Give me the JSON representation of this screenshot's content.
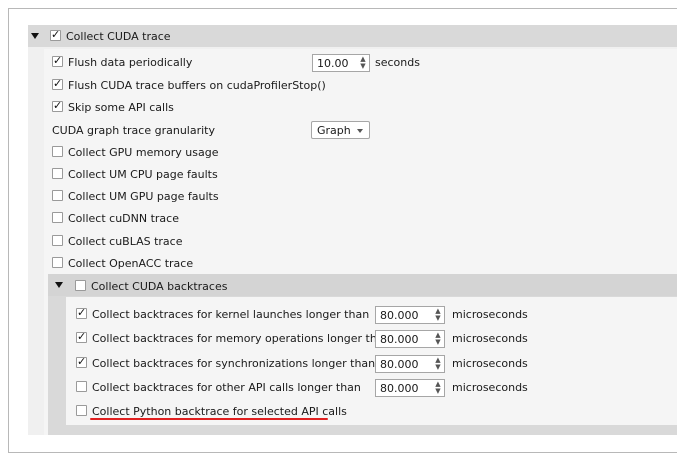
{
  "cuda_trace": {
    "label": "Collect CUDA trace",
    "checked": true,
    "flush_periodically": {
      "label": "Flush data periodically",
      "checked": true,
      "value": "10.00",
      "unit": "seconds"
    },
    "flush_on_stop": {
      "label": "Flush CUDA trace buffers on cudaProfilerStop()",
      "checked": true
    },
    "skip_api": {
      "label": "Skip some API calls",
      "checked": true
    },
    "graph_granularity": {
      "label": "CUDA graph trace granularity",
      "value": "Graph"
    },
    "options": [
      {
        "label": "Collect GPU memory usage",
        "checked": false
      },
      {
        "label": "Collect UM CPU page faults",
        "checked": false
      },
      {
        "label": "Collect UM GPU page faults",
        "checked": false
      },
      {
        "label": "Collect cuDNN trace",
        "checked": false
      },
      {
        "label": "Collect cuBLAS trace",
        "checked": false
      },
      {
        "label": "Collect OpenACC trace",
        "checked": false
      }
    ]
  },
  "backtraces": {
    "label": "Collect CUDA backtraces",
    "checked": false,
    "unit": "microseconds",
    "rows": [
      {
        "label": "Collect backtraces for kernel launches longer than",
        "checked": true,
        "value": "80.000"
      },
      {
        "label": "Collect backtraces for memory operations longer than",
        "checked": true,
        "value": "80.000"
      },
      {
        "label": "Collect backtraces for synchronizations longer than",
        "checked": true,
        "value": "80.000"
      },
      {
        "label": "Collect backtraces for other API calls longer than",
        "checked": false,
        "value": "80.000"
      }
    ],
    "python": {
      "label": "Collect Python backtrace for selected API calls",
      "checked": false
    }
  },
  "colors": {
    "highlight_underline": "#e02020",
    "header_bg": "#d9d9d9"
  }
}
